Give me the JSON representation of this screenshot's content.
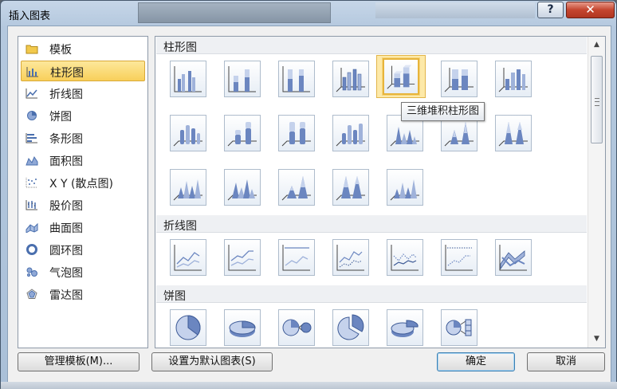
{
  "window": {
    "title": "插入图表",
    "help_glyph": "?",
    "close_glyph": "✕"
  },
  "categories": [
    {
      "label": "模板",
      "icon": "folder-icon"
    },
    {
      "label": "柱形图",
      "icon": "column-chart-icon",
      "selected": true
    },
    {
      "label": "折线图",
      "icon": "line-chart-icon"
    },
    {
      "label": "饼图",
      "icon": "pie-chart-icon"
    },
    {
      "label": "条形图",
      "icon": "bar-chart-icon"
    },
    {
      "label": "面积图",
      "icon": "area-chart-icon"
    },
    {
      "label": "X Y (散点图)",
      "icon": "scatter-chart-icon"
    },
    {
      "label": "股价图",
      "icon": "stock-chart-icon"
    },
    {
      "label": "曲面图",
      "icon": "surface-chart-icon"
    },
    {
      "label": "圆环图",
      "icon": "doughnut-chart-icon"
    },
    {
      "label": "气泡图",
      "icon": "bubble-chart-icon"
    },
    {
      "label": "雷达图",
      "icon": "radar-chart-icon"
    }
  ],
  "gallery": {
    "sections": [
      {
        "label": "柱形图"
      },
      {
        "label": "折线图"
      },
      {
        "label": "饼图"
      }
    ],
    "tooltip": "三维堆积柱形图"
  },
  "buttons": {
    "manage_templates": "管理模板(M)...",
    "set_default": "设置为默认图表(S)",
    "ok": "确定",
    "cancel": "取消"
  },
  "colors": {
    "selection": "#f8cf5a",
    "chart_blue": "#5b78b8",
    "close_red": "#c4452f"
  }
}
